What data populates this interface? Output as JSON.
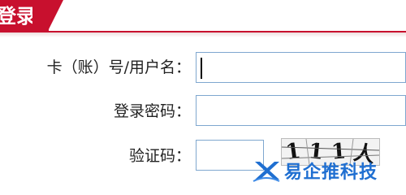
{
  "tab": {
    "title": "登录"
  },
  "form": {
    "account_label": "卡（账）号/用户名：",
    "password_label": "登录密码：",
    "captcha_label": "验证码：",
    "account_value": "",
    "password_value": "",
    "captcha_value": ""
  },
  "captcha": {
    "chars": [
      "1",
      "1",
      "1",
      "人"
    ]
  },
  "watermark": {
    "text": "易企推科技"
  },
  "colors": {
    "accent": "#c8102e",
    "field_border": "#7fa7cf",
    "watermark": "#1f6fd1"
  }
}
